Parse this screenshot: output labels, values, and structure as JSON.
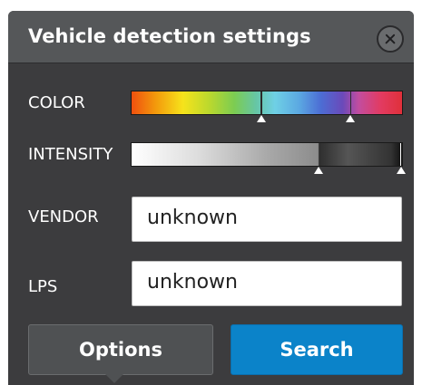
{
  "dialog": {
    "title": "Vehicle detection settings",
    "close_icon": "close-circle-icon"
  },
  "color": {
    "label": "COLOR",
    "range_low": 0.48,
    "range_high": 0.81
  },
  "intensity": {
    "label": "INTENSITY",
    "range_low": 0.69,
    "range_high": 0.995
  },
  "vendor": {
    "label": "VENDOR",
    "value": "unknown"
  },
  "lps": {
    "label": "LPS",
    "value": "unknown"
  },
  "buttons": {
    "options_label": "Options",
    "search_label": "Search"
  },
  "colors": {
    "panel_bg": "#3c3c3e",
    "header_bg": "#555759",
    "search_accent": "#0b83c9",
    "options_bg": "#4f5153"
  }
}
